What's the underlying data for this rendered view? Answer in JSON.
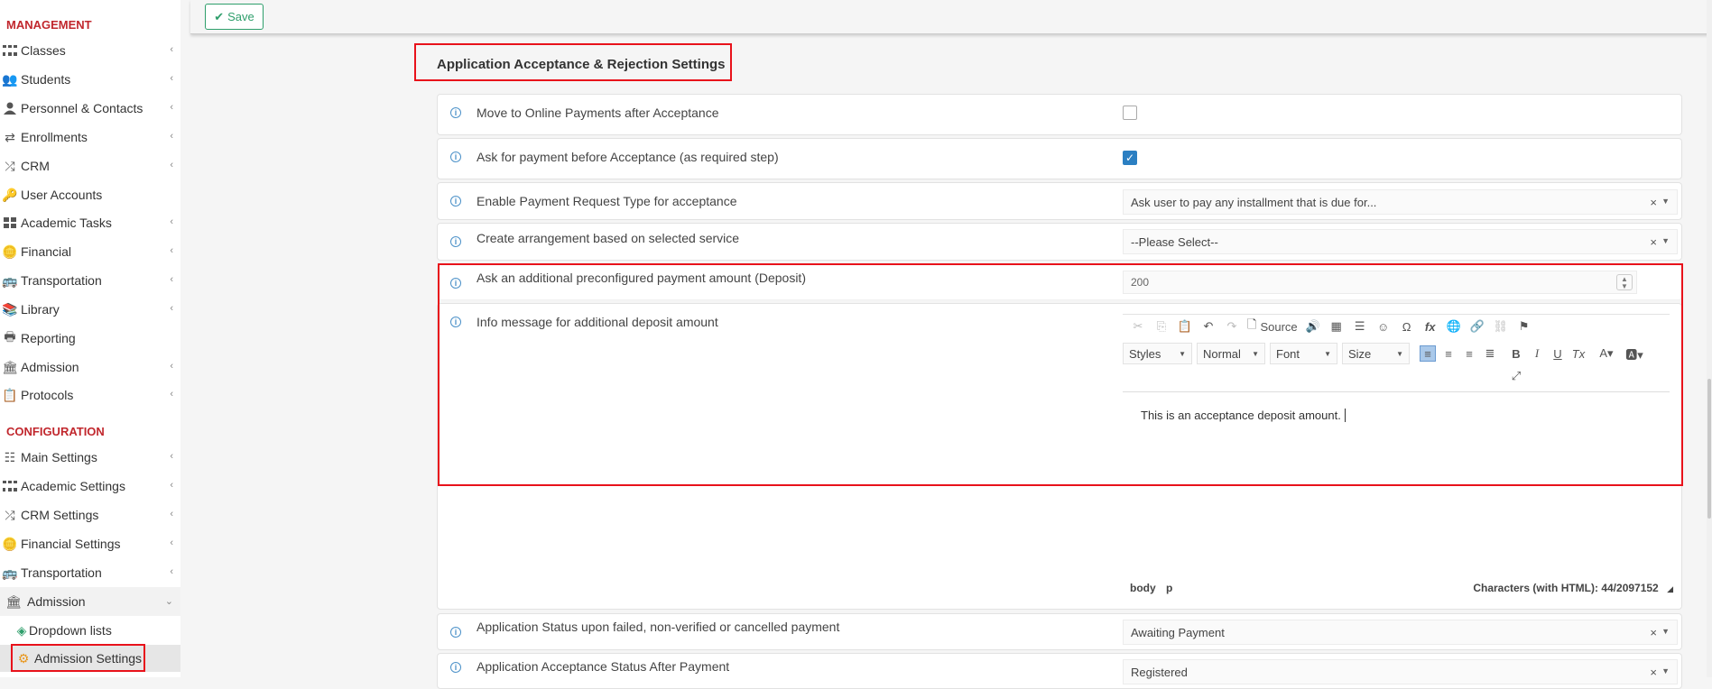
{
  "toolbar": {
    "save_label": "Save"
  },
  "sidebar": {
    "management_title": "MANAGEMENT",
    "management_items": [
      {
        "label": "Classes",
        "icon": "classes-icon"
      },
      {
        "label": "Students",
        "icon": "students-icon"
      },
      {
        "label": "Personnel & Contacts",
        "icon": "personnel-icon"
      },
      {
        "label": "Enrollments",
        "icon": "enrollments-icon"
      },
      {
        "label": "CRM",
        "icon": "crm-icon"
      },
      {
        "label": "User Accounts",
        "icon": "key-icon"
      },
      {
        "label": "Academic Tasks",
        "icon": "tasks-icon"
      },
      {
        "label": "Financial",
        "icon": "coins-icon"
      },
      {
        "label": "Transportation",
        "icon": "bus-icon"
      },
      {
        "label": "Library",
        "icon": "library-icon"
      },
      {
        "label": "Reporting",
        "icon": "print-icon"
      },
      {
        "label": "Admission",
        "icon": "bank-icon"
      },
      {
        "label": "Protocols",
        "icon": "protocols-icon"
      }
    ],
    "configuration_title": "CONFIGURATION",
    "configuration_items": [
      {
        "label": "Main Settings",
        "icon": "sliders-icon"
      },
      {
        "label": "Academic Settings",
        "icon": "classes-icon"
      },
      {
        "label": "CRM Settings",
        "icon": "crm-icon"
      },
      {
        "label": "Financial Settings",
        "icon": "coins-icon"
      },
      {
        "label": "Transportation",
        "icon": "bus-icon"
      },
      {
        "label": "Admission",
        "icon": "bank-icon"
      }
    ],
    "admission_sub": [
      {
        "label": "Dropdown lists",
        "icon": "layers-icon"
      },
      {
        "label": "Admission Settings",
        "icon": "gear-icon"
      }
    ]
  },
  "main": {
    "heading": "Application Acceptance & Rejection Settings",
    "rows": {
      "move_online": "Move to Online Payments after Acceptance",
      "ask_payment": "Ask for payment before Acceptance (as required step)",
      "enable_request": "Enable Payment Request Type for acceptance",
      "create_arrangement": "Create arrangement based on selected service",
      "ask_deposit": "Ask an additional preconfigured payment amount (Deposit)",
      "info_message": "Info message for additional deposit amount",
      "status_failed": "Application Status upon failed, non-verified or cancelled payment",
      "status_after": "Application Acceptance Status After Payment"
    },
    "values": {
      "enable_request": "Ask user to pay any installment that is due for...",
      "create_arrangement": "--Please Select--",
      "deposit_amount": "200",
      "status_failed": "Awaiting Payment",
      "status_after": "Registered"
    },
    "editor": {
      "source_label": "Source",
      "styles": "Styles",
      "format": "Normal",
      "font": "Font",
      "size": "Size",
      "content": "This is an acceptance deposit amount.",
      "path_body": "body",
      "path_p": "p",
      "char_count": "Characters (with HTML): 44/2097152"
    }
  }
}
